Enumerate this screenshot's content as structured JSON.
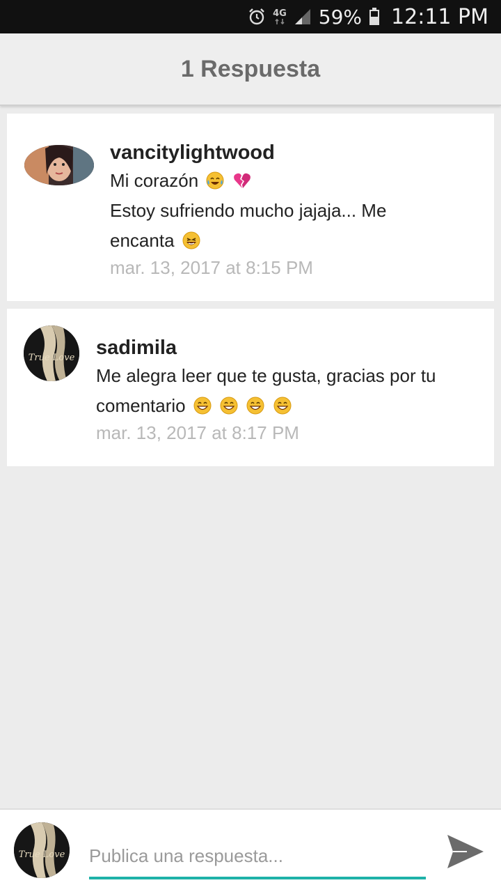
{
  "status_bar": {
    "network_label": "4G",
    "battery_percent": "59%",
    "time": "12:11 PM",
    "icons": [
      "alarm-icon",
      "network-4g-icon",
      "signal-icon",
      "battery-icon"
    ]
  },
  "header": {
    "title": "1 Respuesta"
  },
  "comments": [
    {
      "username": "vancitylightwood",
      "lines": [
        "Mi corazón",
        "Estoy sufriendo mucho jajaja... Me",
        "encanta"
      ],
      "emojis": [
        "crying-laughing-emoji",
        "broken-heart-emoji",
        "laughing-emoji"
      ],
      "timestamp": "mar. 13, 2017 at 8:15 PM"
    },
    {
      "username": "sadimila",
      "lines": [
        "Me alegra leer que te gusta, gracias por tu",
        "comentario"
      ],
      "emojis": [
        "grinning-emoji",
        "grinning-emoji",
        "grinning-emoji",
        "grinning-emoji"
      ],
      "timestamp": "mar. 13, 2017 at 8:17 PM"
    }
  ],
  "reply": {
    "placeholder": "Publica una respuesta...",
    "value": ""
  },
  "colors": {
    "accent": "#1fb2a8",
    "background": "#ececec",
    "header_text": "#6a6a6a",
    "timestamp": "#b8b8b8",
    "send_icon": "#6b6b6b"
  }
}
